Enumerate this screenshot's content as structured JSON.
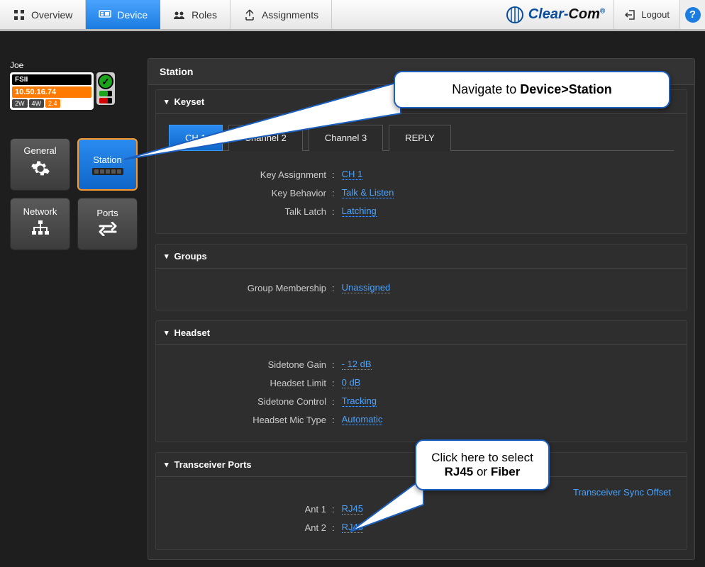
{
  "nav": {
    "overview": "Overview",
    "device": "Device",
    "roles": "Roles",
    "assignments": "Assignments",
    "logout": "Logout",
    "help": "?"
  },
  "brand": {
    "clear": "Clear",
    "com": "Com"
  },
  "user": {
    "name": "Joe"
  },
  "device_card": {
    "model": "FSII",
    "ip": "10.50.16.74",
    "badges": [
      "2W",
      "4W",
      "2.4"
    ]
  },
  "side_tiles": {
    "general": "General",
    "station": "Station",
    "network": "Network",
    "ports": "Ports"
  },
  "main": {
    "title": "Station",
    "keyset": {
      "heading": "Keyset",
      "tabs": [
        "CH 1",
        "Channel 2",
        "Channel 3",
        "REPLY"
      ],
      "rows": {
        "key_assignment": {
          "label": "Key Assignment",
          "value": "CH 1"
        },
        "key_behavior": {
          "label": "Key Behavior",
          "value": "Talk & Listen"
        },
        "talk_latch": {
          "label": "Talk Latch",
          "value": "Latching"
        }
      }
    },
    "groups": {
      "heading": "Groups",
      "membership": {
        "label": "Group Membership",
        "value": "Unassigned"
      }
    },
    "headset": {
      "heading": "Headset",
      "rows": {
        "sidetone_gain": {
          "label": "Sidetone Gain",
          "value": "- 12 dB"
        },
        "headset_limit": {
          "label": "Headset Limit",
          "value": "0 dB"
        },
        "sidetone_control": {
          "label": "Sidetone Control",
          "value": "Tracking"
        },
        "mic_type": {
          "label": "Headset Mic Type",
          "value": "Automatic"
        }
      }
    },
    "transceiver": {
      "heading": "Transceiver Ports",
      "sync_link": "Transceiver Sync Offset",
      "rows": {
        "ant1": {
          "label": "Ant 1",
          "value": "RJ45"
        },
        "ant2": {
          "label": "Ant 2",
          "value": "RJ45"
        }
      }
    }
  },
  "callouts": {
    "nav_hint_pre": "Navigate to ",
    "nav_hint_bold": "Device>Station",
    "port_hint_pre": "Click here to select ",
    "port_hint_b1": "RJ45",
    "port_hint_mid": " or ",
    "port_hint_b2": "Fiber"
  }
}
